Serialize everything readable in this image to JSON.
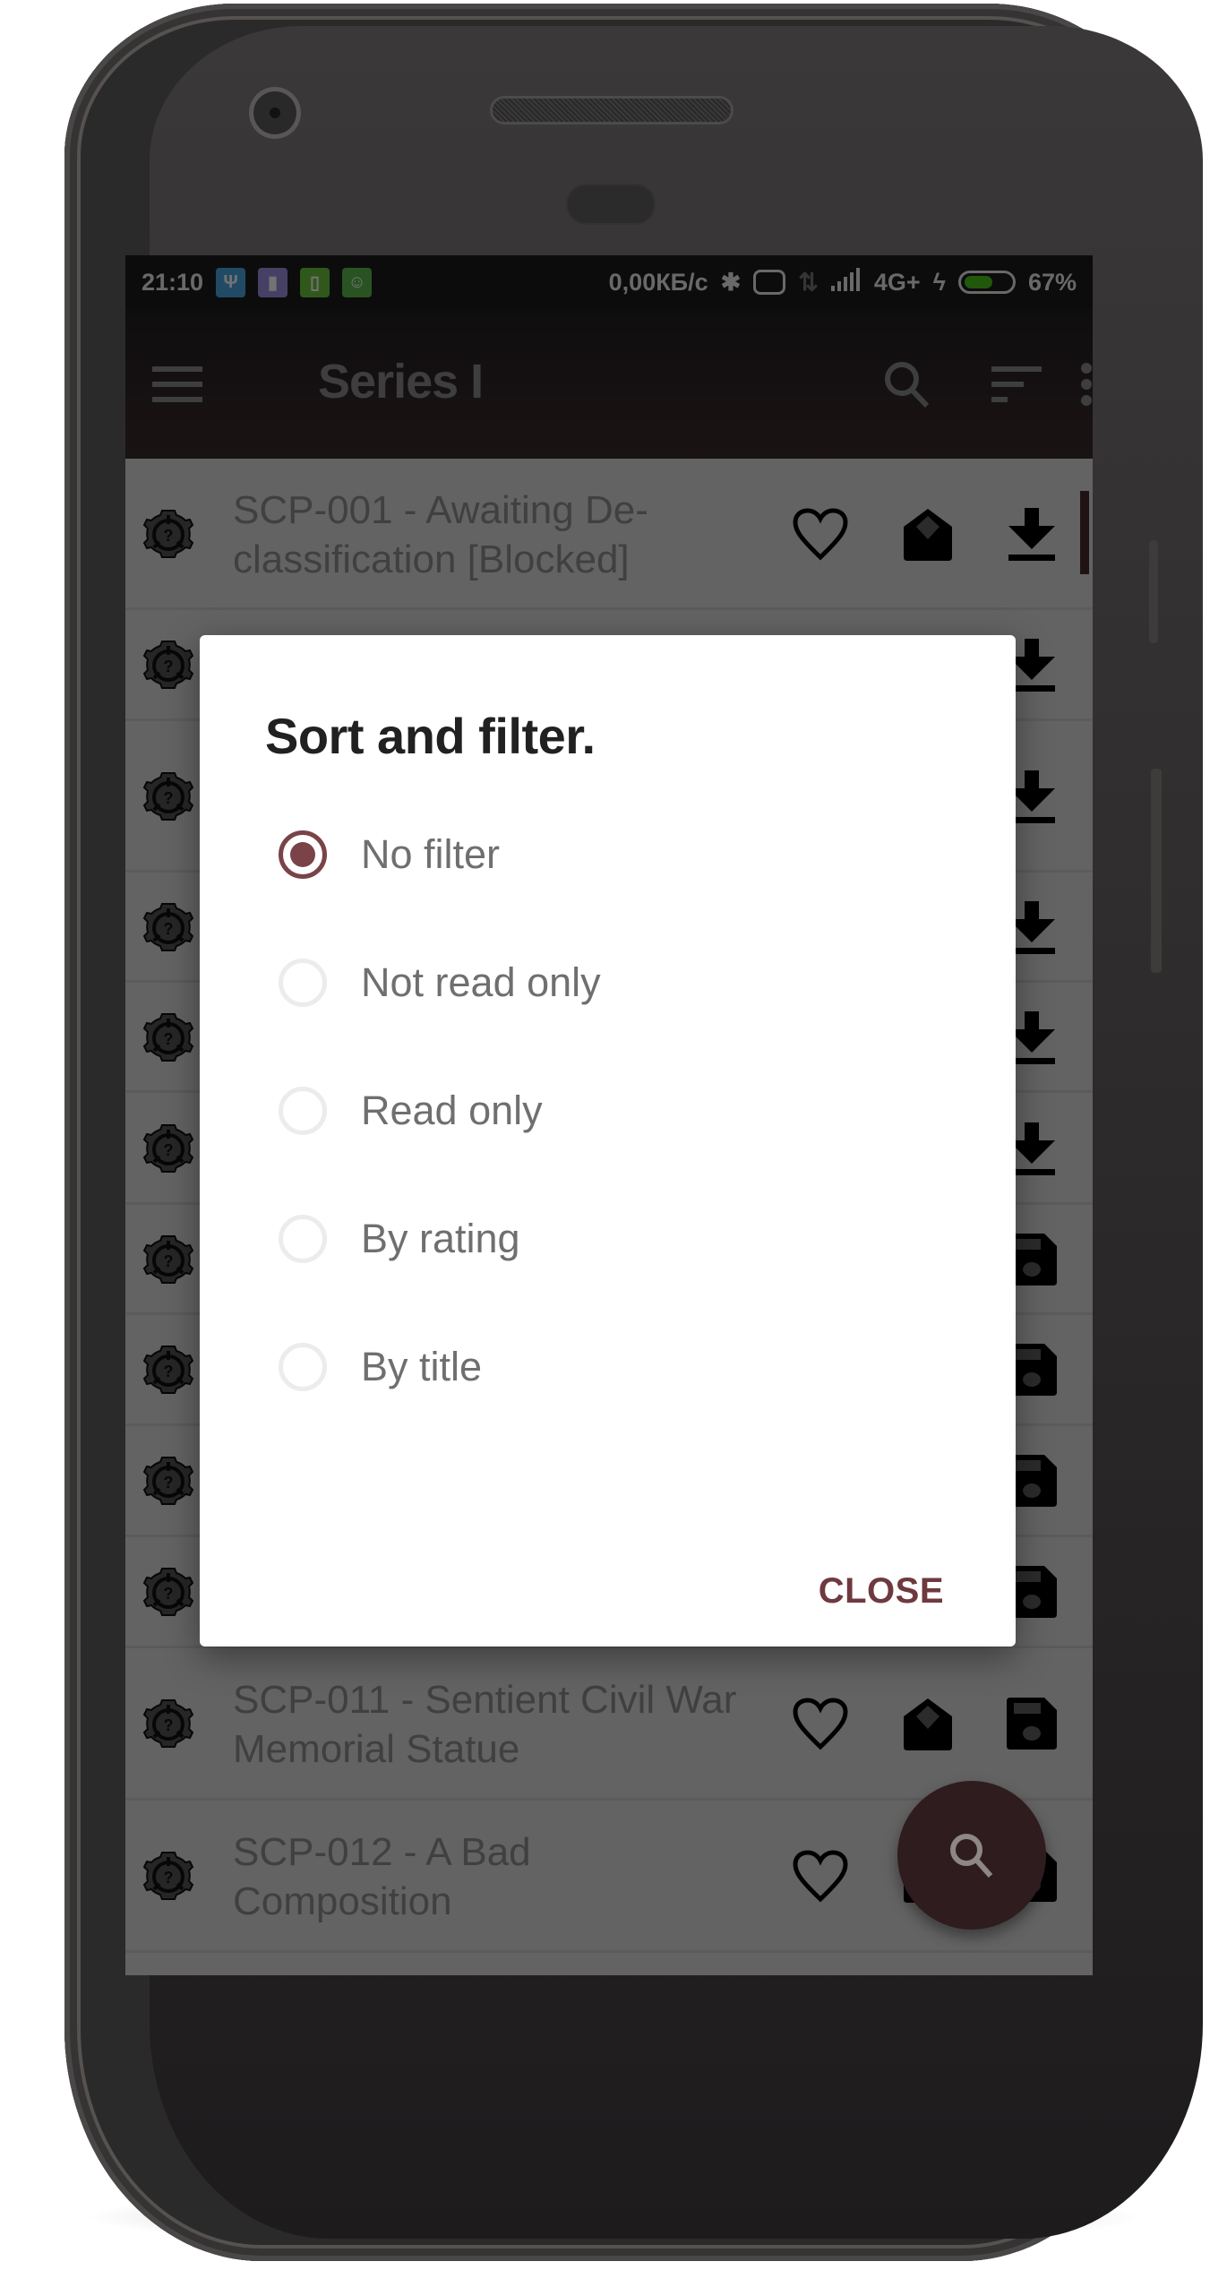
{
  "status_bar": {
    "time": "21:10",
    "notification_icons": [
      {
        "name": "usb-icon",
        "color": "#4aa6e0"
      },
      {
        "name": "sim-card-icon",
        "color": "#9d8ee0"
      },
      {
        "name": "battery-app-icon",
        "color": "#6cc43c"
      },
      {
        "name": "android-icon",
        "color": "#5cb84c"
      }
    ],
    "network_speed": "0,00КБ/с",
    "network_type": "4G+",
    "battery_percent": "67%",
    "battery_level": 0.67,
    "battery_color": "#4ac41a"
  },
  "app_bar": {
    "title": "Series I",
    "menu_icon": "hamburger-menu-icon",
    "actions": [
      "search-icon",
      "sort-icon",
      "more-vert-icon"
    ]
  },
  "list": {
    "rows": [
      {
        "title": "SCP-001 - Awaiting De-classification [Blocked]",
        "title_lines": [
          "SCP-001 - Awaiting De-",
          "classification [Blocked]"
        ],
        "action": "download"
      },
      {
        "title": "",
        "action": "download"
      },
      {
        "title": "",
        "action": "download"
      },
      {
        "title": "",
        "action": "download"
      },
      {
        "title": "",
        "action": "download"
      },
      {
        "title": "",
        "action": "download"
      },
      {
        "title": "",
        "action": "save"
      },
      {
        "title": "",
        "action": "save"
      },
      {
        "title": "",
        "action": "save"
      },
      {
        "title": "",
        "action": "save"
      },
      {
        "title": "SCP-011 - Sentient Civil War Memorial Statue",
        "title_lines": [
          "SCP-011 - Sentient Civil War",
          "Memorial Statue"
        ],
        "action": "save"
      },
      {
        "title": "SCP-012 - A Bad Composition",
        "title_lines": [
          "SCP-012 - A Bad",
          "Composition"
        ],
        "action": "save"
      }
    ]
  },
  "fab": {
    "icon": "search-icon",
    "color": "#2f1c1e"
  },
  "dialog": {
    "title": "Sort and filter.",
    "options": [
      {
        "label": "No filter",
        "checked": true
      },
      {
        "label": "Not read only",
        "checked": false
      },
      {
        "label": "Read only",
        "checked": false
      },
      {
        "label": "By rating",
        "checked": false
      },
      {
        "label": "By title",
        "checked": false
      }
    ],
    "close_label": "CLOSE",
    "accent_color": "#7a4348"
  }
}
